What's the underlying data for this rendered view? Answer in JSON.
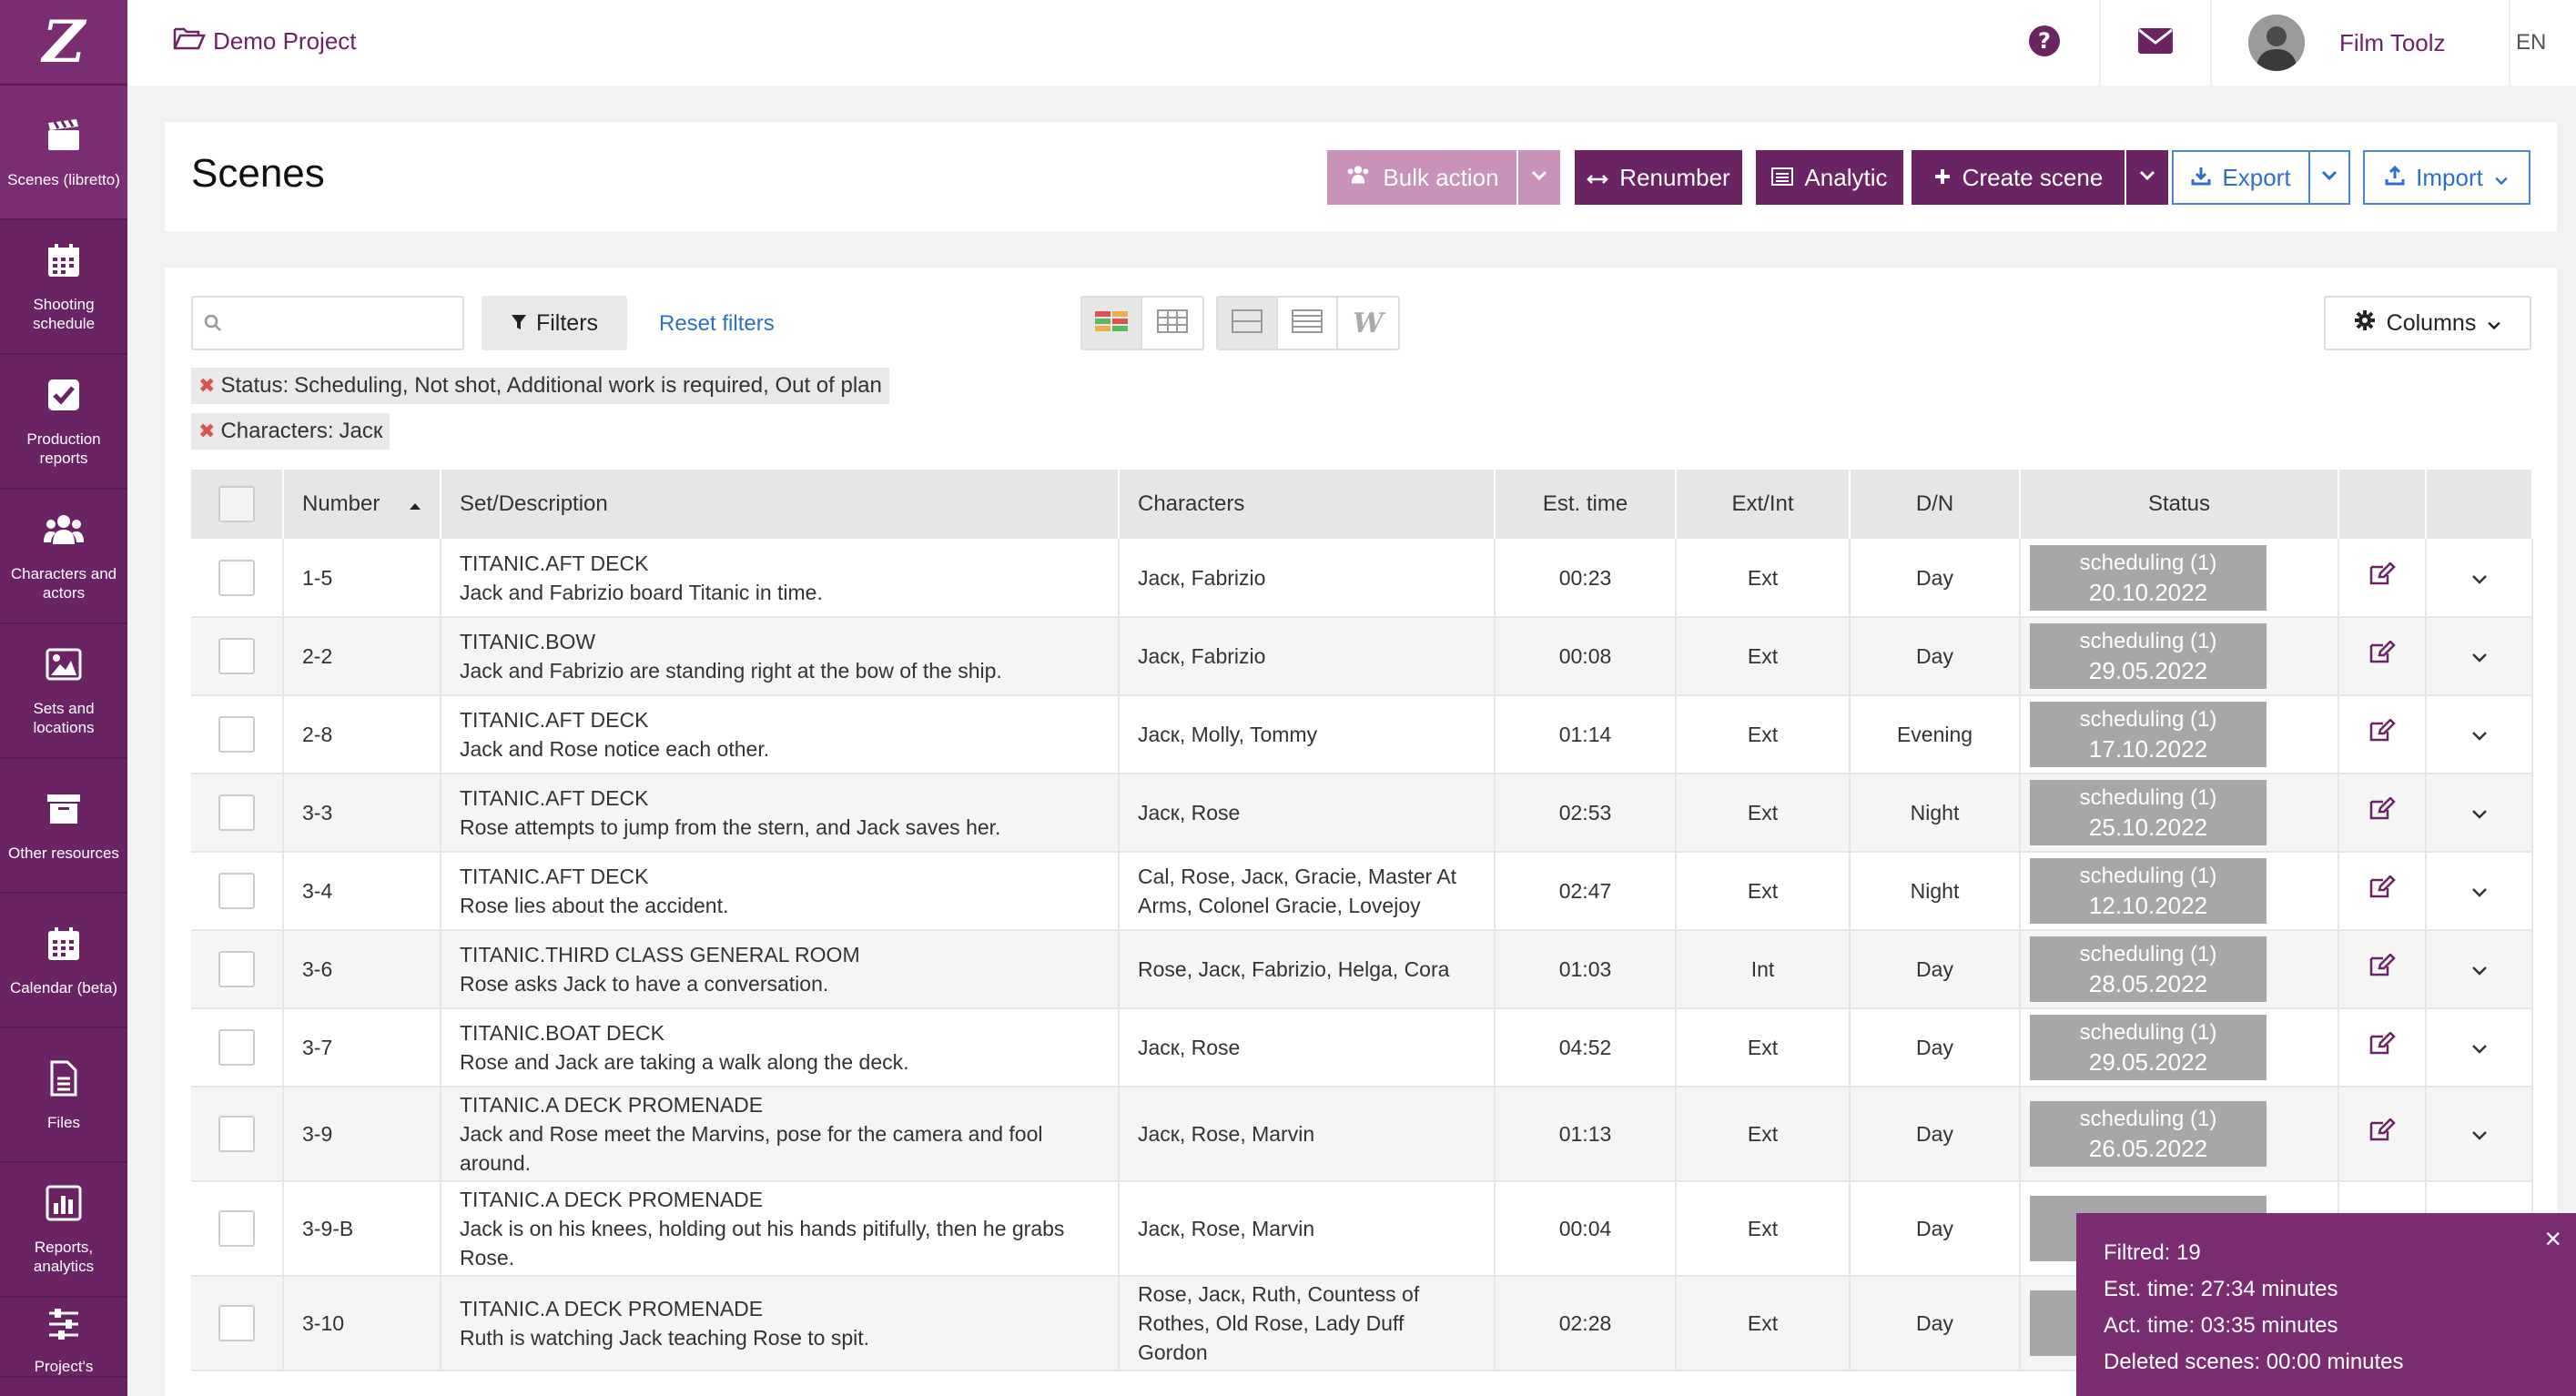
{
  "sidebar": {
    "logo": "Z",
    "items": [
      {
        "label": "Scenes (libretto)",
        "icon": "clapperboard-icon"
      },
      {
        "label": "Shooting schedule",
        "icon": "calendar-grid-icon"
      },
      {
        "label": "Production reports",
        "icon": "checkbox-icon"
      },
      {
        "label": "Characters and actors",
        "icon": "users-icon"
      },
      {
        "label": "Sets and locations",
        "icon": "image-icon"
      },
      {
        "label": "Other resources",
        "icon": "archive-icon"
      },
      {
        "label": "Calendar (beta)",
        "icon": "calendar-icon"
      },
      {
        "label": "Files",
        "icon": "file-icon"
      },
      {
        "label": "Reports, analytics",
        "icon": "bar-chart-icon"
      },
      {
        "label": "Project's",
        "icon": "sliders-icon"
      }
    ]
  },
  "topbar": {
    "project": "Demo Project",
    "user_name": "Film Toolz",
    "lang": "EN"
  },
  "header": {
    "title": "Scenes",
    "bulk_action": "Bulk action",
    "renumber": "Renumber",
    "analytic": "Analytic",
    "create_scene": "Create scene",
    "export": "Export",
    "import": "Import"
  },
  "toolbar": {
    "search_placeholder": "",
    "filters": "Filters",
    "reset_filters": "Reset filters",
    "columns": "Columns",
    "view_w": "W"
  },
  "chips": [
    {
      "key": "Status:",
      "value": "Scheduling, Not shot, Additional work is required, Out of plan"
    },
    {
      "key": "Characters:",
      "value": "Jacк"
    }
  ],
  "table": {
    "headers": [
      "Number",
      "Set/Description",
      "Characters",
      "Est. time",
      "Ext/Int",
      "D/N",
      "Status"
    ],
    "rows": [
      {
        "number": "1-5",
        "set": "TITANIC.AFT DECK",
        "desc": "Jack and Fabrizio board Titanic in time.",
        "characters": "Jacк, Fabrizio",
        "time": "00:23",
        "extint": "Ext",
        "dn": "Day",
        "status": "scheduling (1)",
        "date": "20.10.2022"
      },
      {
        "number": "2-2",
        "set": "TITANIC.BOW",
        "desc": "Jack and Fabrizio are standing right at the bow of the ship.",
        "characters": "Jacк, Fabrizio",
        "time": "00:08",
        "extint": "Ext",
        "dn": "Day",
        "status": "scheduling (1)",
        "date": "29.05.2022"
      },
      {
        "number": "2-8",
        "set": "TITANIC.AFT DECK",
        "desc": "Jack and Rose notice each other.",
        "characters": "Jacк, Molly, Tommy",
        "time": "01:14",
        "extint": "Ext",
        "dn": "Evening",
        "status": "scheduling (1)",
        "date": "17.10.2022"
      },
      {
        "number": "3-3",
        "set": "TITANIC.AFT DECK",
        "desc": "Rose attempts to jump from the stern, and Jack saves her.",
        "characters": "Jacк, Rose",
        "time": "02:53",
        "extint": "Ext",
        "dn": "Night",
        "status": "scheduling (1)",
        "date": "25.10.2022"
      },
      {
        "number": "3-4",
        "set": "TITANIC.AFT DECK",
        "desc": "Rose lies about the accident.",
        "characters": "Cal, Rose, Jacк, Gracie, Master At Arms, Colonel Gracie, Lovejoy",
        "time": "02:47",
        "extint": "Ext",
        "dn": "Night",
        "status": "scheduling (1)",
        "date": "12.10.2022"
      },
      {
        "number": "3-6",
        "set": "TITANIC.THIRD CLASS GENERAL ROOM",
        "desc": "Rose asks Jack to have a conversation.",
        "characters": "Rose, Jacк, Fabrizio, Helga, Cora",
        "time": "01:03",
        "extint": "Int",
        "dn": "Day",
        "status": "scheduling (1)",
        "date": "28.05.2022"
      },
      {
        "number": "3-7",
        "set": "TITANIC.BOAT DECK",
        "desc": "Rose and Jack are taking a walk along the deck.",
        "characters": "Jacк, Rose",
        "time": "04:52",
        "extint": "Ext",
        "dn": "Day",
        "status": "scheduling (1)",
        "date": "29.05.2022"
      },
      {
        "number": "3-9",
        "set": "TITANIC.A DECK PROMENADE",
        "desc": "Jack and Rose meet the Marvins, pose for the camera and fool around.",
        "characters": "Jacк, Rose, Marvin",
        "time": "01:13",
        "extint": "Ext",
        "dn": "Day",
        "status": "scheduling (1)",
        "date": "26.05.2022"
      },
      {
        "number": "3-9-B",
        "set": "TITANIC.A DECK PROMENADE",
        "desc": "Jack is on his knees, holding out his hands pitifully, then he grabs Rose.",
        "characters": "Jacк, Rose, Marvin",
        "time": "00:04",
        "extint": "Ext",
        "dn": "Day",
        "status": "",
        "date": ""
      },
      {
        "number": "3-10",
        "set": "TITANIC.A DECK PROMENADE",
        "desc": "Ruth is watching Jack teaching Rose to spit.",
        "characters": "Rose, Jacк, Ruth, Countess of Rothes, Old Rose, Lady Duff Gordon",
        "time": "02:28",
        "extint": "Ext",
        "dn": "Day",
        "status": "",
        "date": ""
      }
    ]
  },
  "toast": {
    "filtered": "Filtred: 19",
    "est_time": "Est. time: 27:34 minutes",
    "act_time": "Act. time: 03:35 minutes",
    "deleted": "Deleted scenes: 00:00 minutes",
    "close": "×"
  },
  "colors": {
    "brand": "#6b2463",
    "accent_blue": "#2f6fc4",
    "status_gray": "#a7a7a7"
  }
}
